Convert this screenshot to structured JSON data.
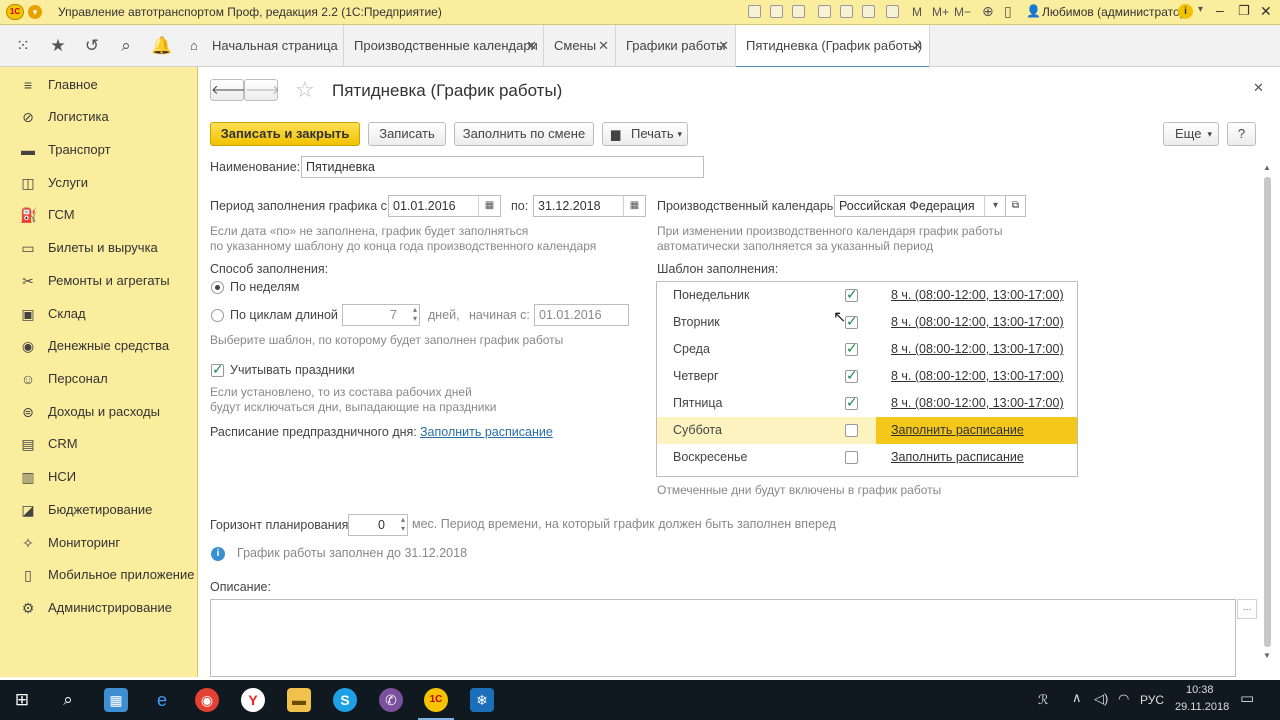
{
  "window": {
    "title": "Управление автотранспортом Проф, редакция 2.2  (1С:Предприятие)",
    "user": "Любимов (администратор)"
  },
  "tabs": [
    {
      "label": "Начальная страница"
    },
    {
      "label": "Производственные календари"
    },
    {
      "label": "Смены"
    },
    {
      "label": "Графики работы"
    },
    {
      "label": "Пятидневка (График работы)"
    }
  ],
  "sidebar": {
    "items": [
      {
        "label": "Главное"
      },
      {
        "label": "Логистика"
      },
      {
        "label": "Транспорт"
      },
      {
        "label": "Услуги"
      },
      {
        "label": "ГСМ"
      },
      {
        "label": "Билеты и выручка"
      },
      {
        "label": "Ремонты и агрегаты"
      },
      {
        "label": "Склад"
      },
      {
        "label": "Денежные средства"
      },
      {
        "label": "Персонал"
      },
      {
        "label": "Доходы и расходы"
      },
      {
        "label": "CRM"
      },
      {
        "label": "НСИ"
      },
      {
        "label": "Бюджетирование"
      },
      {
        "label": "Мониторинг"
      },
      {
        "label": "Мобильное приложение"
      },
      {
        "label": "Администрирование"
      }
    ]
  },
  "form": {
    "title": "Пятидневка (График работы)",
    "btn_save_close": "Записать и закрыть",
    "btn_save": "Записать",
    "btn_fill_shift": "Заполнить по смене",
    "btn_print": "Печать",
    "btn_more": "Еще",
    "btn_help": "?",
    "name_label": "Наименование:",
    "name_value": "Пятидневка",
    "period_label": "Период заполнения графика с:",
    "period_from": "01.01.2016",
    "period_to_label": "по:",
    "period_to": "31.12.2018",
    "period_hint1": "Если дата «по» не заполнена, график будет заполняться",
    "period_hint2": "по указанному шаблону до конца года производственного календаря",
    "calendar_label": "Производственный календарь:",
    "calendar_value": "Российская Федерация",
    "calendar_hint1": "При изменении производственного календаря график работы",
    "calendar_hint2": "автоматически заполняется за указанный период",
    "method_label": "Способ заполнения:",
    "method_weeks": "По неделям",
    "method_cycles": "По циклам длиной",
    "cycle_length": "7",
    "days_label": "дней,",
    "start_label": "начиная с:",
    "start_date": "01.01.2016",
    "method_hint": "Выберите шаблон, по которому будет заполнен график работы",
    "holidays_label": "Учитывать праздники",
    "holidays_hint1": "Если установлено, то из состава рабочих дней",
    "holidays_hint2": "будут исключаться дни, выпадающие на праздники",
    "preholiday_label": "Расписание предпраздничного дня:",
    "preholiday_link": "Заполнить расписание",
    "template_label": "Шаблон заполнения:",
    "template_hint": "Отмеченные дни будут включены в график работы",
    "template_rows": [
      {
        "day": "Понедельник",
        "checked": true,
        "value": "8 ч. (08:00-12:00, 13:00-17:00)"
      },
      {
        "day": "Вторник",
        "checked": true,
        "value": "8 ч. (08:00-12:00, 13:00-17:00)"
      },
      {
        "day": "Среда",
        "checked": true,
        "value": "8 ч. (08:00-12:00, 13:00-17:00)"
      },
      {
        "day": "Четверг",
        "checked": true,
        "value": "8 ч. (08:00-12:00, 13:00-17:00)"
      },
      {
        "day": "Пятница",
        "checked": true,
        "value": "8 ч. (08:00-12:00, 13:00-17:00)"
      },
      {
        "day": "Суббота",
        "checked": false,
        "value": "Заполнить расписание"
      },
      {
        "day": "Воскресенье",
        "checked": false,
        "value": "Заполнить расписание"
      }
    ],
    "horizon_label": "Горизонт планирования:",
    "horizon_value": "0",
    "horizon_hint": "мес. Период времени, на который график должен быть заполнен вперед",
    "info_text": "График работы заполнен до 31.12.2018",
    "desc_label": "Описание:"
  },
  "taskbar": {
    "lang": "РУС",
    "time": "10:38",
    "date": "29.11.2018"
  },
  "colors": {
    "sidebar": "#fbed9e",
    "primary_button": "#f2c200",
    "link": "#2a6ea8",
    "check": "#1a8a4e"
  }
}
